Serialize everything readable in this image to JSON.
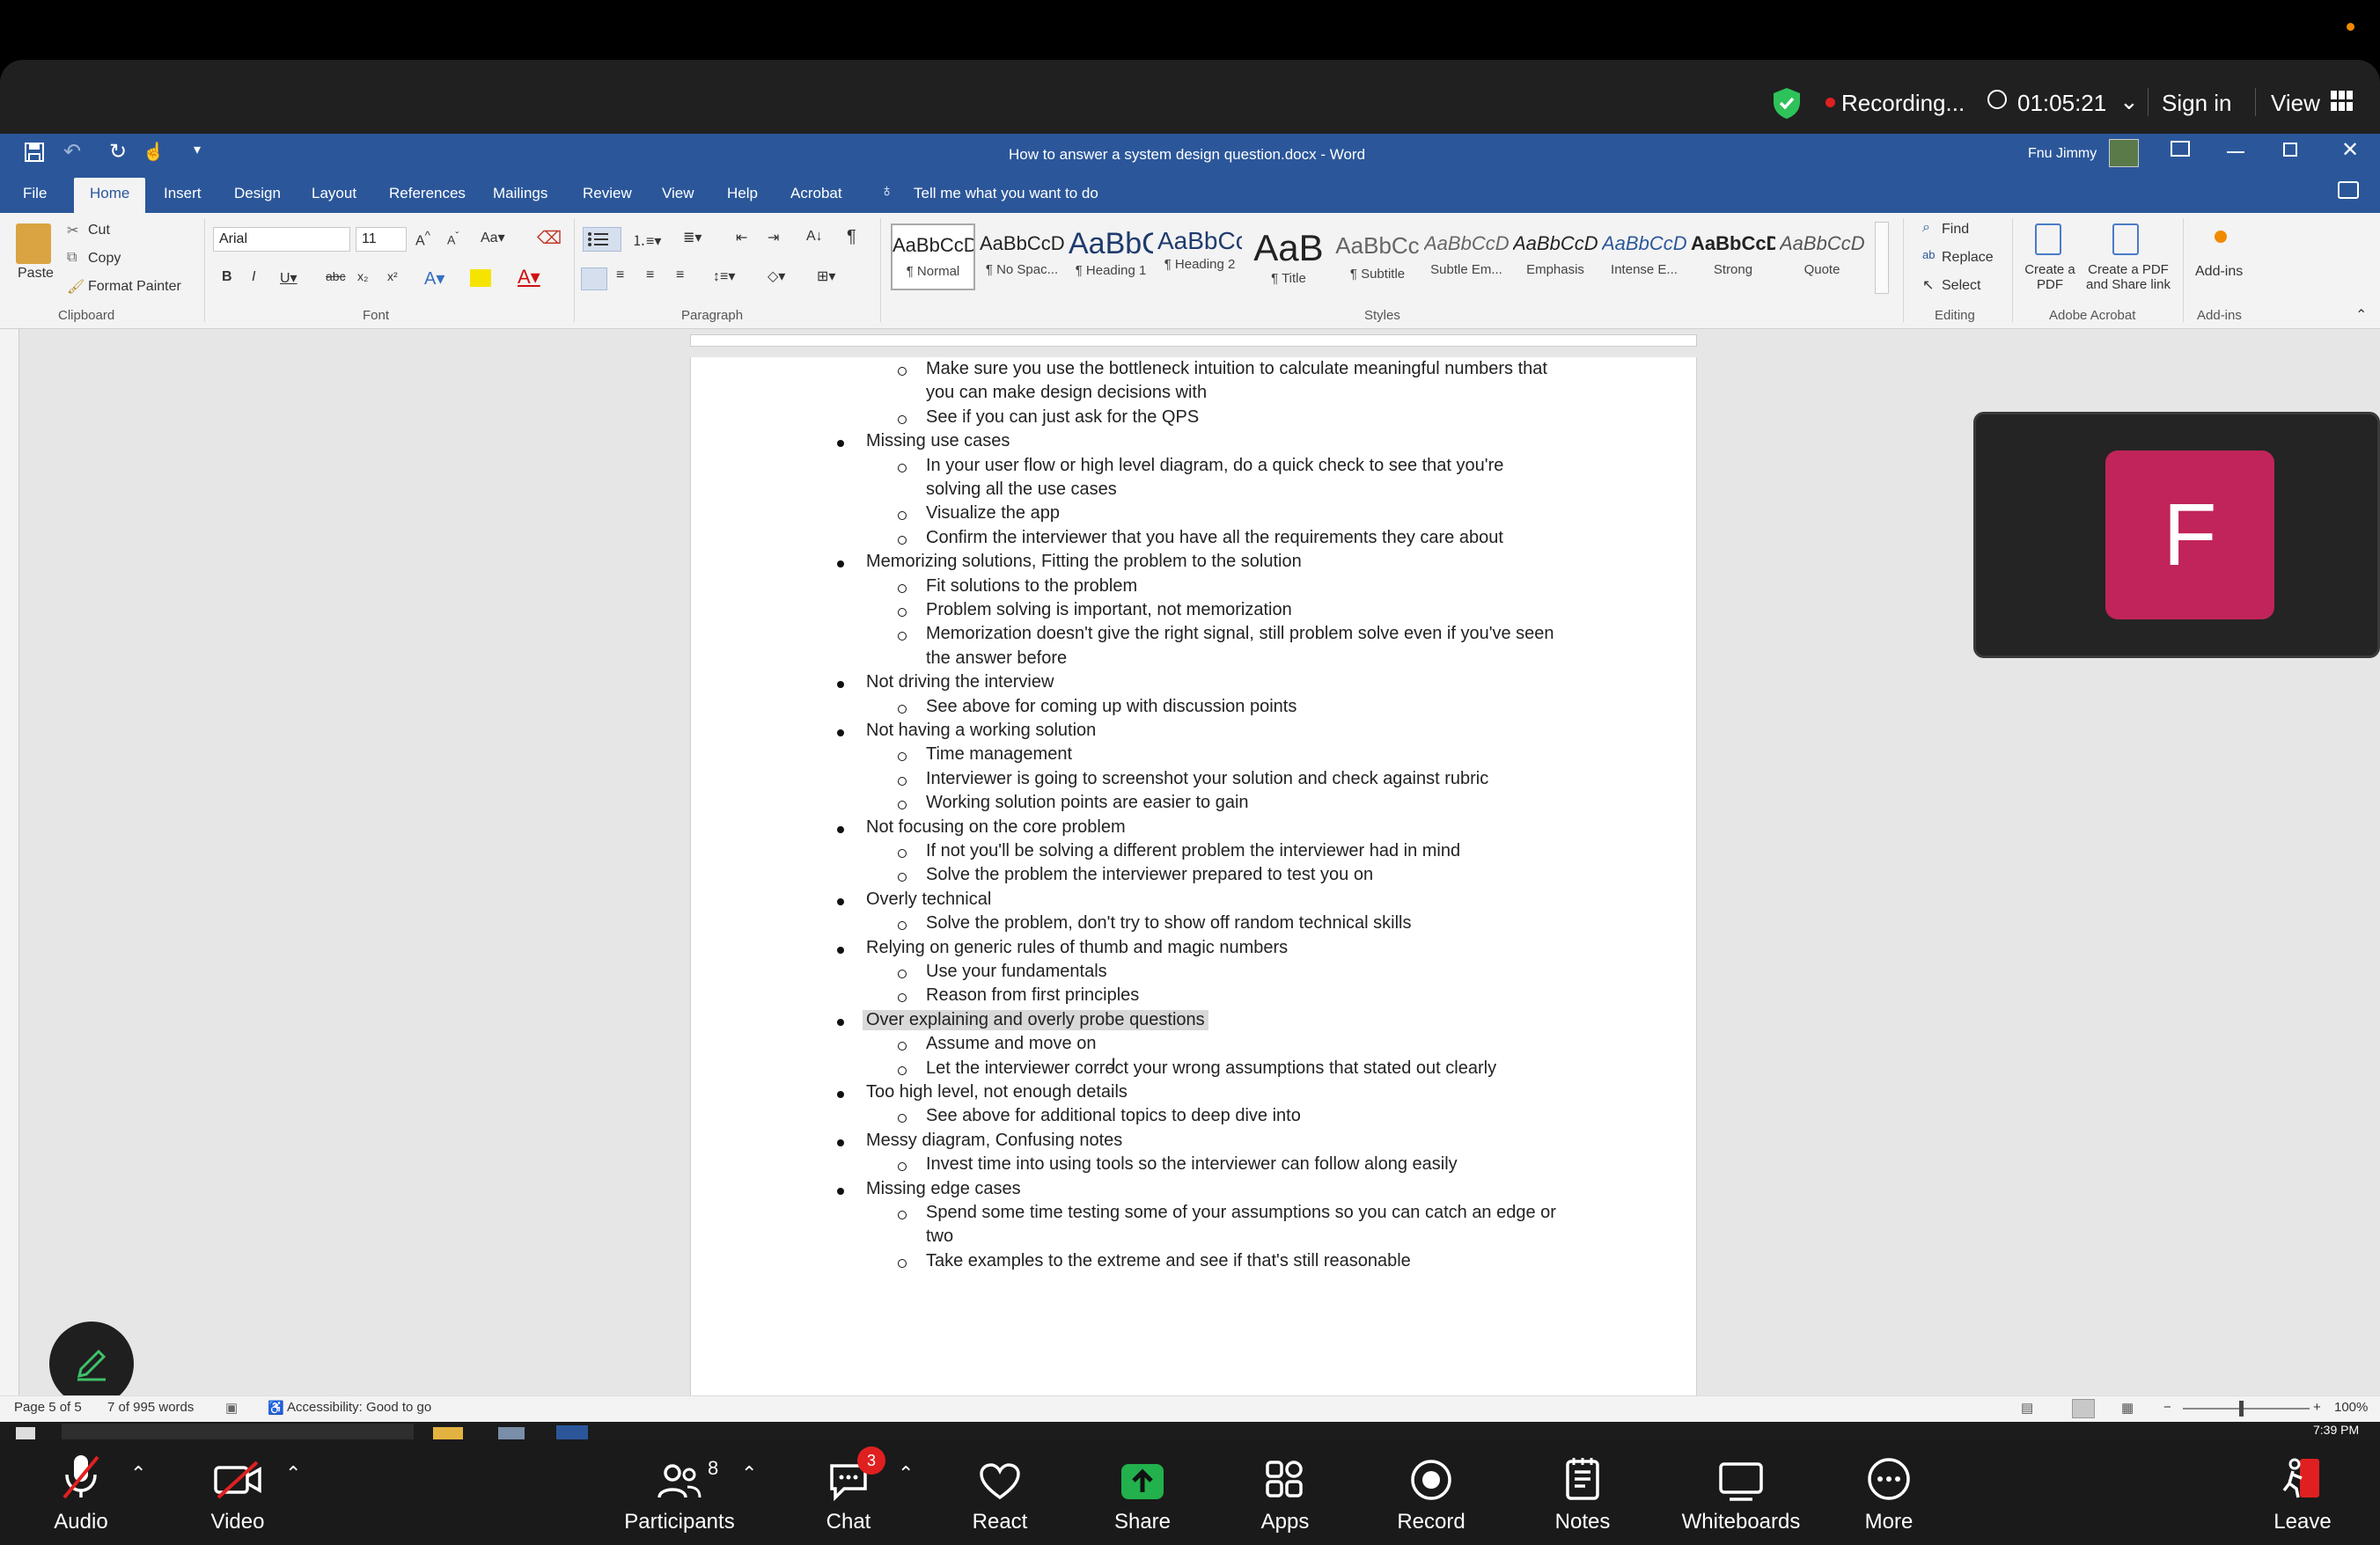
{
  "zoom": {
    "recording_label": "Recording...",
    "timer": "01:05:21",
    "sign_in": "Sign in",
    "view": "View",
    "toolbar": {
      "audio": "Audio",
      "video": "Video",
      "participants": "Participants",
      "participants_count": "8",
      "chat": "Chat",
      "chat_badge": "3",
      "react": "React",
      "share": "Share",
      "apps": "Apps",
      "record": "Record",
      "notes": "Notes",
      "whiteboards": "Whiteboards",
      "more": "More",
      "leave": "Leave"
    },
    "participant_initial": "F",
    "colors": {
      "avatar": "#c1245a",
      "share": "#22b14c",
      "recording_dot": "#e02020"
    }
  },
  "word": {
    "window_title": "How to answer a system design question.docx - Word",
    "user_name": "Fnu Jimmy",
    "tabs": [
      "File",
      "Home",
      "Insert",
      "Design",
      "Layout",
      "References",
      "Mailings",
      "Review",
      "View",
      "Help",
      "Acrobat"
    ],
    "tell_me": "Tell me what you want to do",
    "clipboard": {
      "paste": "Paste",
      "cut": "Cut",
      "copy": "Copy",
      "format_painter": "Format Painter",
      "group": "Clipboard"
    },
    "font": {
      "name": "Arial",
      "size": "11",
      "group": "Font"
    },
    "paragraph_group": "Paragraph",
    "styles_group": "Styles",
    "styles": [
      {
        "preview": "AaBbCcDc",
        "name": "¶ Normal"
      },
      {
        "preview": "AaBbCcDc",
        "name": "¶ No Spac..."
      },
      {
        "preview": "AaBbC",
        "name": "¶ Heading 1"
      },
      {
        "preview": "AaBbCc",
        "name": "¶ Heading 2"
      },
      {
        "preview": "AaB",
        "name": "¶ Title"
      },
      {
        "preview": "AaBbCc",
        "name": "¶ Subtitle"
      },
      {
        "preview": "AaBbCcDc",
        "name": "Subtle Em..."
      },
      {
        "preview": "AaBbCcDc",
        "name": "Emphasis"
      },
      {
        "preview": "AaBbCcDc",
        "name": "Intense E..."
      },
      {
        "preview": "AaBbCcDc",
        "name": "Strong"
      },
      {
        "preview": "AaBbCcDc",
        "name": "Quote"
      }
    ],
    "editing": {
      "find": "Find",
      "replace": "Replace",
      "select": "Select",
      "group": "Editing"
    },
    "acrobat": {
      "create_pdf": "Create a PDF",
      "create_share": "Create a PDF and Share link",
      "group": "Adobe Acrobat"
    },
    "addins": {
      "label": "Add-ins",
      "group": "Add-ins"
    },
    "status": {
      "page": "Page 5 of 5",
      "words": "7 of 995 words",
      "accessibility": "Accessibility: Good to go",
      "zoom": "100%"
    },
    "clock": "7:39 PM"
  },
  "document": {
    "lines": [
      {
        "level": 2,
        "text": "Make sure you use the bottleneck intuition to calculate meaningful numbers that",
        "bullet": true
      },
      {
        "level": 2,
        "text": "you can make design decisions with",
        "bullet": false
      },
      {
        "level": 2,
        "text": "See if you can just ask for the QPS",
        "bullet": true
      },
      {
        "level": 1,
        "text": "Missing use cases",
        "bullet": true
      },
      {
        "level": 2,
        "text": "In your user flow or high level diagram, do a quick check to see that you're",
        "bullet": true
      },
      {
        "level": 2,
        "text": "solving all the use cases",
        "bullet": false
      },
      {
        "level": 2,
        "text": "Visualize the app",
        "bullet": true
      },
      {
        "level": 2,
        "text": "Confirm the interviewer that you have all the requirements they care about",
        "bullet": true
      },
      {
        "level": 1,
        "text": "Memorizing solutions, Fitting the problem to the solution",
        "bullet": true
      },
      {
        "level": 2,
        "text": "Fit solutions to the problem",
        "bullet": true
      },
      {
        "level": 2,
        "text": "Problem solving is important, not memorization",
        "bullet": true
      },
      {
        "level": 2,
        "text": "Memorization doesn't give the right signal, still problem solve even if you've seen",
        "bullet": true
      },
      {
        "level": 2,
        "text": "the answer before",
        "bullet": false
      },
      {
        "level": 1,
        "text": "Not driving the interview",
        "bullet": true
      },
      {
        "level": 2,
        "text": "See above for coming up with discussion points",
        "bullet": true
      },
      {
        "level": 1,
        "text": "Not having a working solution",
        "bullet": true
      },
      {
        "level": 2,
        "text": "Time management",
        "bullet": true
      },
      {
        "level": 2,
        "text": "Interviewer is going to screenshot your solution and check against rubric",
        "bullet": true
      },
      {
        "level": 2,
        "text": "Working solution points are easier to gain",
        "bullet": true
      },
      {
        "level": 1,
        "text": "Not focusing on the core problem",
        "bullet": true
      },
      {
        "level": 2,
        "text": "If not you'll be solving a different problem the interviewer had in mind",
        "bullet": true
      },
      {
        "level": 2,
        "text": "Solve the problem the interviewer prepared to test you on",
        "bullet": true
      },
      {
        "level": 1,
        "text": "Overly technical",
        "bullet": true
      },
      {
        "level": 2,
        "text": "Solve the problem, don't try to show off random technical skills",
        "bullet": true
      },
      {
        "level": 1,
        "text": "Relying on generic rules of thumb and magic numbers",
        "bullet": true
      },
      {
        "level": 2,
        "text": "Use your fundamentals",
        "bullet": true
      },
      {
        "level": 2,
        "text": "Reason from first principles",
        "bullet": true
      },
      {
        "level": 1,
        "text": "Over explaining and overly probe questions",
        "bullet": true,
        "selected": true
      },
      {
        "level": 2,
        "text": "Assume and move on",
        "bullet": true
      },
      {
        "level": 2,
        "text": "Let the interviewer correct your wrong assumptions that stated out clearly",
        "bullet": true
      },
      {
        "level": 1,
        "text": "Too high level, not enough details",
        "bullet": true
      },
      {
        "level": 2,
        "text": "See above for additional topics to deep dive into",
        "bullet": true
      },
      {
        "level": 1,
        "text": "Messy diagram, Confusing notes",
        "bullet": true
      },
      {
        "level": 2,
        "text": "Invest time into using tools so the interviewer can follow along easily",
        "bullet": true
      },
      {
        "level": 1,
        "text": "Missing edge cases",
        "bullet": true
      },
      {
        "level": 2,
        "text": "Spend some time testing some of your assumptions so you can catch an edge or",
        "bullet": true
      },
      {
        "level": 2,
        "text": "two",
        "bullet": false
      },
      {
        "level": 2,
        "text": "Take examples to the extreme and see if that's still reasonable",
        "bullet": true
      }
    ]
  }
}
